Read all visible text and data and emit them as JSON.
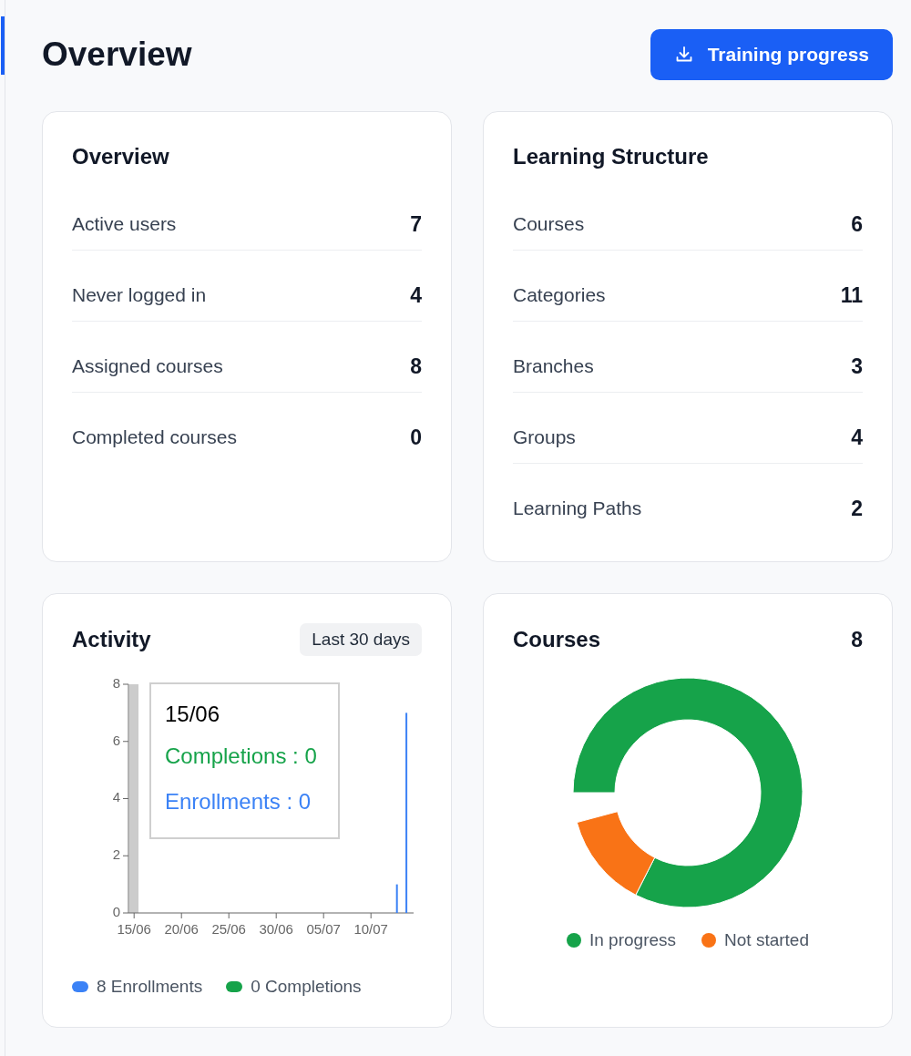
{
  "page": {
    "title": "Overview",
    "action_button": {
      "label": "Training progress"
    }
  },
  "overview_card": {
    "title": "Overview",
    "rows": [
      {
        "label": "Active users",
        "value": "7"
      },
      {
        "label": "Never logged in",
        "value": "4"
      },
      {
        "label": "Assigned courses",
        "value": "8"
      },
      {
        "label": "Completed courses",
        "value": "0"
      }
    ]
  },
  "structure_card": {
    "title": "Learning Structure",
    "rows": [
      {
        "label": "Courses",
        "value": "6"
      },
      {
        "label": "Categories",
        "value": "11"
      },
      {
        "label": "Branches",
        "value": "3"
      },
      {
        "label": "Groups",
        "value": "4"
      },
      {
        "label": "Learning Paths",
        "value": "2"
      }
    ]
  },
  "activity_card": {
    "title": "Activity",
    "range_button": "Last 30 days",
    "chart_data": {
      "type": "bar",
      "categories": [
        "15/06",
        null,
        null,
        null,
        null,
        "20/06",
        null,
        null,
        null,
        null,
        "25/06",
        null,
        null,
        null,
        null,
        "30/06",
        null,
        null,
        null,
        null,
        "05/07",
        null,
        null,
        null,
        null,
        "10/07",
        null,
        null,
        null,
        null
      ],
      "series": [
        {
          "name": "Enrollments",
          "color": "#3b82f6",
          "values": [
            0,
            0,
            0,
            0,
            0,
            0,
            0,
            0,
            0,
            0,
            0,
            0,
            0,
            0,
            0,
            0,
            0,
            0,
            0,
            0,
            0,
            0,
            0,
            0,
            0,
            0,
            0,
            0,
            1,
            7
          ]
        },
        {
          "name": "Completions",
          "color": "#16a34a",
          "values": [
            0,
            0,
            0,
            0,
            0,
            0,
            0,
            0,
            0,
            0,
            0,
            0,
            0,
            0,
            0,
            0,
            0,
            0,
            0,
            0,
            0,
            0,
            0,
            0,
            0,
            0,
            0,
            0,
            0,
            0
          ]
        }
      ],
      "ylim": [
        0,
        8
      ],
      "yticks": [
        0,
        2,
        4,
        6,
        8
      ]
    },
    "tooltip": {
      "title": "15/06",
      "items": [
        {
          "label": "Completions : 0",
          "color": "#16a34a"
        },
        {
          "label": "Enrollments : 0",
          "color": "#3b82f6"
        }
      ]
    },
    "legend": [
      {
        "count": "8"
      },
      {
        "count": "0"
      }
    ]
  },
  "courses_card": {
    "title": "Courses",
    "count": "8",
    "legend": [
      {
        "label": "In progress",
        "color": "#16a34a"
      },
      {
        "label": "Not started",
        "color": "#f97316"
      }
    ]
  }
}
